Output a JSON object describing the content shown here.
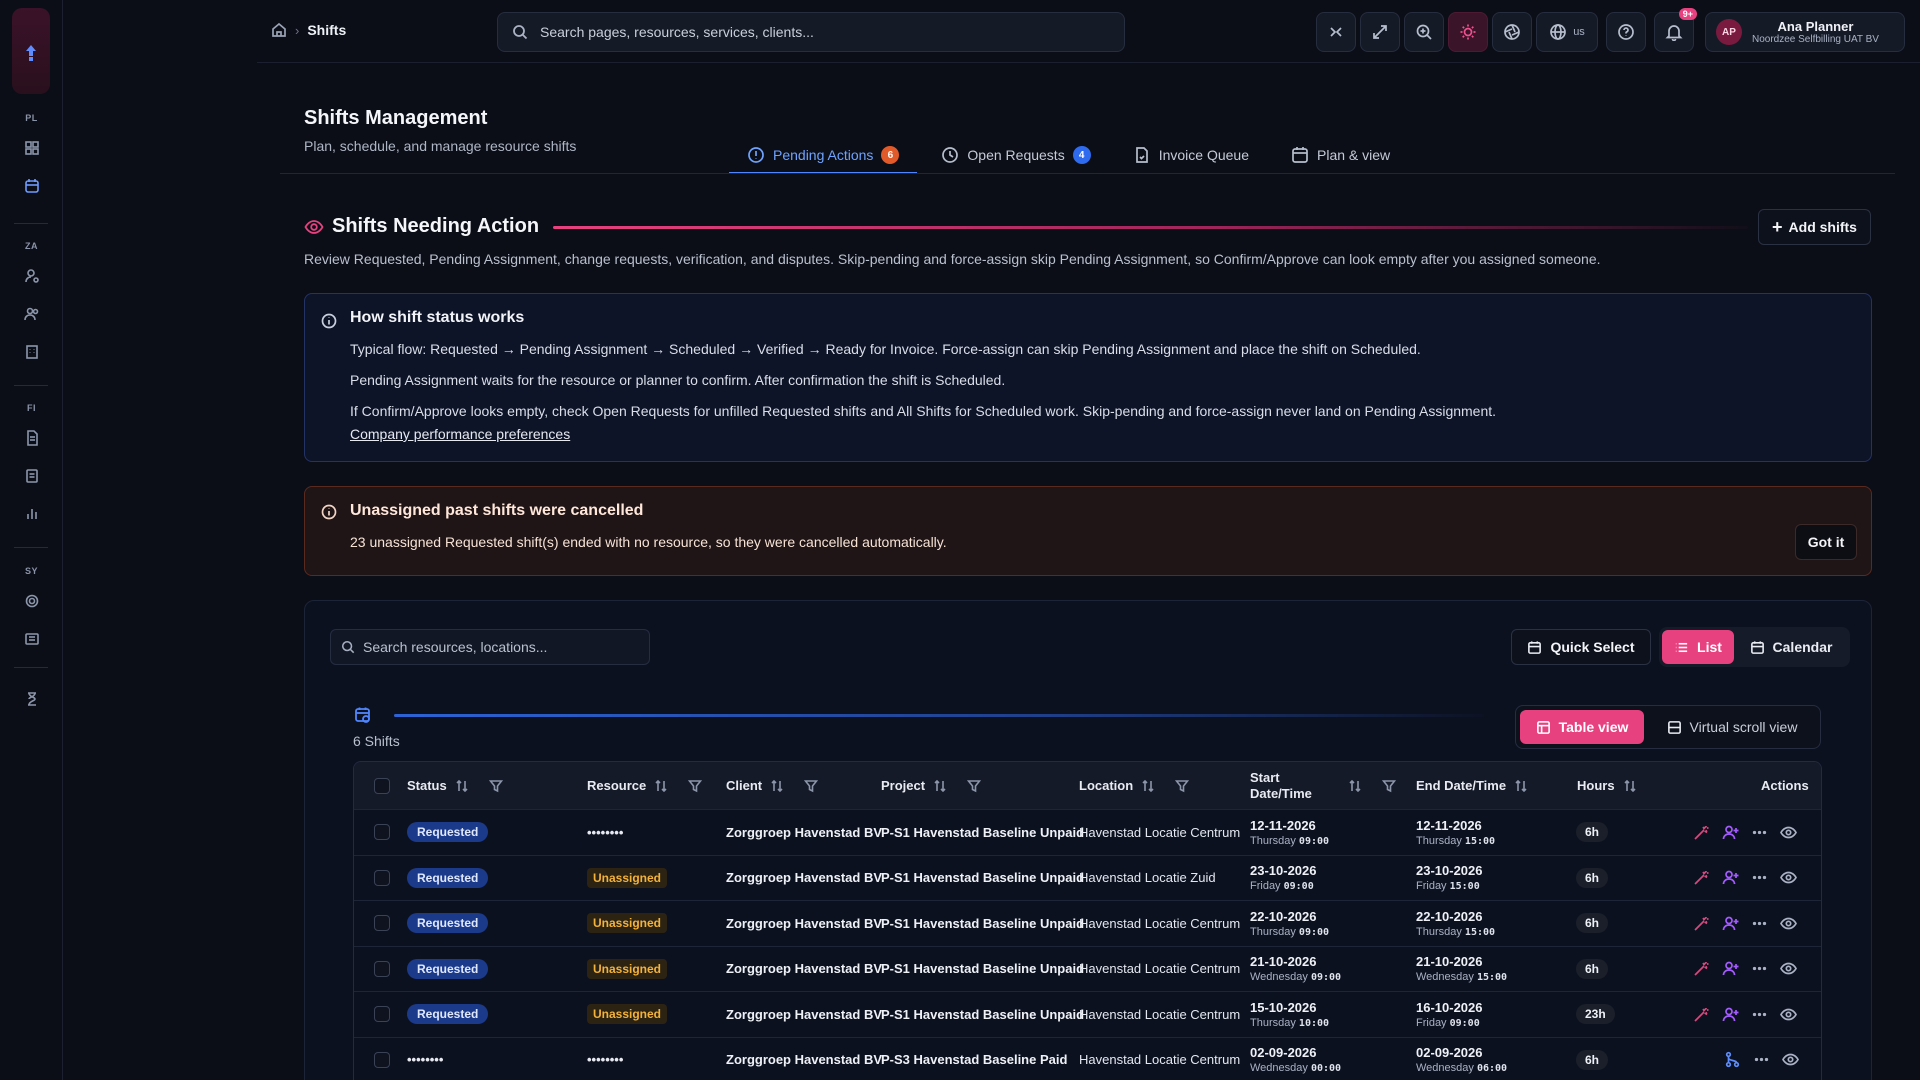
{
  "breadcrumb": {
    "current": "Shifts"
  },
  "search": {
    "placeholder": "Search pages, resources, services, clients..."
  },
  "topbar": {
    "language": "us",
    "notifications_badge": "9+",
    "user": {
      "initials": "AP",
      "name": "Ana Planner",
      "org": "Noordzee Selfbilling UAT BV"
    }
  },
  "rail": {
    "sections": [
      "PL",
      "ZA",
      "FI",
      "SY"
    ]
  },
  "page": {
    "title": "Shifts Management",
    "subtitle": "Plan, schedule, and manage resource shifts"
  },
  "tabs": [
    {
      "label": "Pending Actions",
      "count": "6",
      "count_color": "#e05a2a",
      "active": true,
      "icon": "alert-circle-icon"
    },
    {
      "label": "Open Requests",
      "count": "4",
      "count_color": "#2f6bef",
      "active": false,
      "icon": "clock-icon"
    },
    {
      "label": "Invoice Queue",
      "count": "",
      "active": false,
      "icon": "document-icon"
    },
    {
      "label": "Plan & view",
      "count": "",
      "active": false,
      "icon": "calendar-icon"
    }
  ],
  "section": {
    "title": "Shifts Needing Action",
    "add_label": "Add shifts",
    "description": "Review Requested, Pending Assignment, change requests, verification, and disputes. Skip-pending and force-assign skip Pending Assignment, so Confirm/Approve can look empty after you assigned someone."
  },
  "info": {
    "title": "How shift status works",
    "lines": [
      "Typical flow: Requested → Pending Assignment → Scheduled → Verified → Ready for Invoice. Force-assign can skip Pending Assignment and place the shift on Scheduled.",
      "Pending Assignment waits for the resource or planner to confirm. After confirmation the shift is Scheduled.",
      "If Confirm/Approve looks empty, check Open Requests for unfilled Requested shifts and All Shifts for Scheduled work. Skip-pending and force-assign never land on Pending Assignment."
    ],
    "link": "Company performance preferences"
  },
  "warning": {
    "title": "Unassigned past shifts were cancelled",
    "message": "23 unassigned Requested shift(s) ended with no resource, so they were cancelled automatically.",
    "button": "Got it"
  },
  "table_panel": {
    "search_placeholder": "Search resources, locations...",
    "quick_select": "Quick Select",
    "list_label": "List",
    "calendar_label": "Calendar",
    "count_label": "6 Shifts",
    "table_view": "Table view",
    "virtual_view": "Virtual scroll view",
    "columns": {
      "status": "Status",
      "resource": "Resource",
      "client": "Client",
      "project": "Project",
      "location": "Location",
      "start": "Start Date/Time",
      "end": "End Date/Time",
      "hours": "Hours",
      "actions": "Actions"
    },
    "rows": [
      {
        "status": "Requested",
        "resource": "••••••••",
        "resource_unassigned": false,
        "client": "Zorggroep Havenstad BV",
        "project": "P-S1 Havenstad Baseline Unpaid",
        "location": "Havenstad Locatie Centrum",
        "start_date": "12-11-2026",
        "start_day": "Thursday",
        "start_time": "09:00",
        "end_date": "12-11-2026",
        "end_day": "Thursday",
        "end_time": "15:00",
        "hours": "6h",
        "kind": "full"
      },
      {
        "status": "Requested",
        "resource": "Unassigned",
        "resource_unassigned": true,
        "client": "Zorggroep Havenstad BV",
        "project": "P-S1 Havenstad Baseline Unpaid",
        "location": "Havenstad Locatie Zuid",
        "start_date": "23-10-2026",
        "start_day": "Friday",
        "start_time": "09:00",
        "end_date": "23-10-2026",
        "end_day": "Friday",
        "end_time": "15:00",
        "hours": "6h",
        "kind": "full"
      },
      {
        "status": "Requested",
        "resource": "Unassigned",
        "resource_unassigned": true,
        "client": "Zorggroep Havenstad BV",
        "project": "P-S1 Havenstad Baseline Unpaid",
        "location": "Havenstad Locatie Centrum",
        "start_date": "22-10-2026",
        "start_day": "Thursday",
        "start_time": "09:00",
        "end_date": "22-10-2026",
        "end_day": "Thursday",
        "end_time": "15:00",
        "hours": "6h",
        "kind": "full"
      },
      {
        "status": "Requested",
        "resource": "Unassigned",
        "resource_unassigned": true,
        "client": "Zorggroep Havenstad BV",
        "project": "P-S1 Havenstad Baseline Unpaid",
        "location": "Havenstad Locatie Centrum",
        "start_date": "21-10-2026",
        "start_day": "Wednesday",
        "start_time": "09:00",
        "end_date": "21-10-2026",
        "end_day": "Wednesday",
        "end_time": "15:00",
        "hours": "6h",
        "kind": "full"
      },
      {
        "status": "Requested",
        "resource": "Unassigned",
        "resource_unassigned": true,
        "client": "Zorggroep Havenstad BV",
        "project": "P-S1 Havenstad Baseline Unpaid",
        "location": "Havenstad Locatie Centrum",
        "start_date": "15-10-2026",
        "start_day": "Thursday",
        "start_time": "10:00",
        "end_date": "16-10-2026",
        "end_day": "Friday",
        "end_time": "09:00",
        "hours": "23h",
        "kind": "full"
      },
      {
        "status": "••••••••",
        "resource": "••••••••",
        "resource_unassigned": false,
        "client": "Zorggroep Havenstad BV",
        "project": "P-S3 Havenstad Baseline Paid",
        "location": "Havenstad Locatie Centrum",
        "start_date": "02-09-2026",
        "start_day": "Wednesday",
        "start_time": "00:00",
        "end_date": "02-09-2026",
        "end_day": "Wednesday",
        "end_time": "06:00",
        "hours": "6h",
        "kind": "change"
      }
    ]
  }
}
